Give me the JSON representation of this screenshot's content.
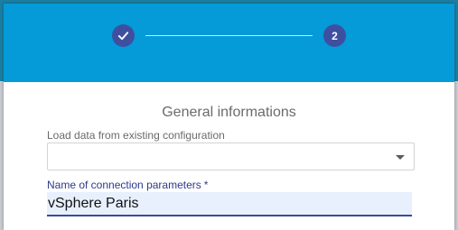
{
  "colors": {
    "header": "#059ad8",
    "step_circle": "#3f4fa0",
    "label_accent": "#2d3a8c",
    "input_fill": "#e8f0fe"
  },
  "stepper": {
    "steps": [
      {
        "state": "completed",
        "icon": "check-icon"
      },
      {
        "state": "current",
        "number": "2"
      }
    ]
  },
  "form": {
    "title": "General informations",
    "load_label": "Load data from existing configuration",
    "load_value": "",
    "name_label": "Name of connection parameters",
    "name_required_mark": "*",
    "name_value": "vSphere Paris"
  }
}
